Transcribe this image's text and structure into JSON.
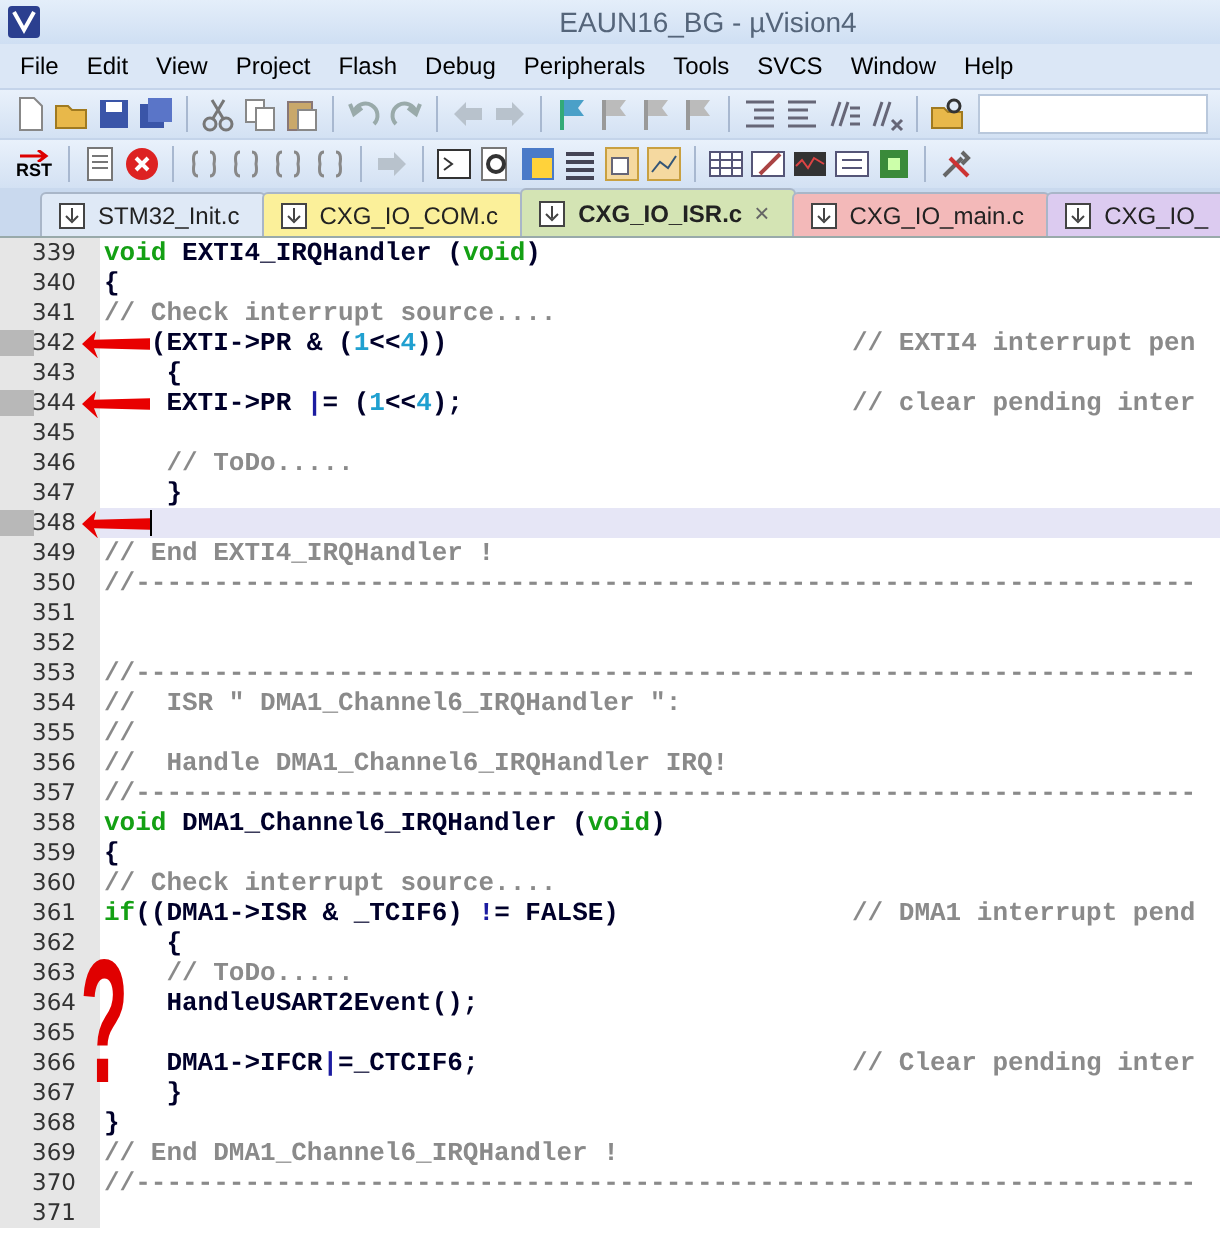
{
  "window": {
    "title": "EAUN16_BG  - µVision4"
  },
  "menu": [
    "File",
    "Edit",
    "View",
    "Project",
    "Flash",
    "Debug",
    "Peripherals",
    "Tools",
    "SVCS",
    "Window",
    "Help"
  ],
  "toolbar2": {
    "reset_label": "RST"
  },
  "tabs": [
    {
      "label": "STM32_Init.c",
      "selected": false,
      "color": "#dfe9f6"
    },
    {
      "label": "CXG_IO_COM.c",
      "selected": false,
      "color": "#fbf09a"
    },
    {
      "label": "CXG_IO_ISR.c",
      "selected": true,
      "color": "#d4e4b4",
      "close": "×"
    },
    {
      "label": "CXG_IO_main.c",
      "selected": false,
      "color": "#f3b9b9"
    },
    {
      "label": "CXG_IO_",
      "selected": false,
      "color": "#dccbf0"
    }
  ],
  "code_lines": [
    {
      "number": "339",
      "segments": [
        {
          "kind": "keyword",
          "text": "void"
        },
        {
          "kind": "plain",
          "text": " EXTI4_IRQHandler ("
        },
        {
          "kind": "keyword",
          "text": "void"
        },
        {
          "kind": "plain",
          "text": ")"
        }
      ]
    },
    {
      "number": "340",
      "segments": [
        {
          "kind": "plain",
          "text": "{"
        }
      ]
    },
    {
      "number": "341",
      "segments": [
        {
          "kind": "comment",
          "text": "// Check interrupt source...."
        }
      ]
    },
    {
      "number": "342",
      "segments": [
        {
          "kind": "plain",
          "text": "   (EXTI->PR & ("
        },
        {
          "kind": "number",
          "text": "1"
        },
        {
          "kind": "plain",
          "text": "<<"
        },
        {
          "kind": "number",
          "text": "4"
        },
        {
          "kind": "plain",
          "text": "))"
        }
      ],
      "comment": "// EXTI4 interrupt pen",
      "marked": true,
      "arrow": true
    },
    {
      "number": "343",
      "segments": [
        {
          "kind": "plain",
          "text": "    {"
        }
      ]
    },
    {
      "number": "344",
      "segments": [
        {
          "kind": "plain",
          "text": "    EXTI->PR "
        },
        {
          "kind": "operator",
          "text": "|"
        },
        {
          "kind": "plain",
          "text": "= ("
        },
        {
          "kind": "number",
          "text": "1"
        },
        {
          "kind": "plain",
          "text": "<<"
        },
        {
          "kind": "number",
          "text": "4"
        },
        {
          "kind": "plain",
          "text": ");"
        }
      ],
      "comment": "// clear pending inter",
      "marked": true,
      "arrow": true
    },
    {
      "number": "345"
    },
    {
      "number": "346",
      "segments": [
        {
          "kind": "comment",
          "text": "    // ToDo....."
        }
      ]
    },
    {
      "number": "347",
      "segments": [
        {
          "kind": "plain",
          "text": "    }"
        }
      ]
    },
    {
      "number": "348",
      "marked": true,
      "arrow": true,
      "current": true
    },
    {
      "number": "349",
      "segments": [
        {
          "kind": "comment",
          "text": "// End EXTI4_IRQHandler !"
        }
      ]
    },
    {
      "number": "350",
      "segments": [
        {
          "kind": "comment",
          "text": "//--------------------------------------------------------------------"
        }
      ]
    },
    {
      "number": "351"
    },
    {
      "number": "352"
    },
    {
      "number": "353",
      "segments": [
        {
          "kind": "comment",
          "text": "//--------------------------------------------------------------------"
        }
      ]
    },
    {
      "number": "354",
      "segments": [
        {
          "kind": "comment",
          "text": "//  ISR \" DMA1_Channel6_IRQHandler \":"
        }
      ]
    },
    {
      "number": "355",
      "segments": [
        {
          "kind": "comment",
          "text": "//"
        }
      ]
    },
    {
      "number": "356",
      "segments": [
        {
          "kind": "comment",
          "text": "//  Handle DMA1_Channel6_IRQHandler IRQ!"
        }
      ]
    },
    {
      "number": "357",
      "segments": [
        {
          "kind": "comment",
          "text": "//--------------------------------------------------------------------"
        }
      ]
    },
    {
      "number": "358",
      "segments": [
        {
          "kind": "keyword",
          "text": "void"
        },
        {
          "kind": "plain",
          "text": " DMA1_Channel6_IRQHandler ("
        },
        {
          "kind": "keyword",
          "text": "void"
        },
        {
          "kind": "plain",
          "text": ")"
        }
      ]
    },
    {
      "number": "359",
      "segments": [
        {
          "kind": "plain",
          "text": "{"
        }
      ]
    },
    {
      "number": "360",
      "segments": [
        {
          "kind": "comment",
          "text": "// Check interrupt source...."
        }
      ]
    },
    {
      "number": "361",
      "segments": [
        {
          "kind": "keyword",
          "text": "if"
        },
        {
          "kind": "plain",
          "text": "((DMA1->ISR & _TCIF6) "
        },
        {
          "kind": "operator",
          "text": "!"
        },
        {
          "kind": "plain",
          "text": "= FALSE)"
        }
      ],
      "comment": "// DMA1 interrupt pend"
    },
    {
      "number": "362",
      "segments": [
        {
          "kind": "plain",
          "text": "    {"
        }
      ]
    },
    {
      "number": "363",
      "segments": [
        {
          "kind": "comment",
          "text": "    // ToDo....."
        }
      ]
    },
    {
      "number": "364",
      "segments": [
        {
          "kind": "plain",
          "text": "    HandleUSART2Event();"
        }
      ]
    },
    {
      "number": "365"
    },
    {
      "number": "366",
      "segments": [
        {
          "kind": "plain",
          "text": "    DMA1->IFCR"
        },
        {
          "kind": "operator",
          "text": "|"
        },
        {
          "kind": "plain",
          "text": "=_CTCIF6;"
        }
      ],
      "comment": "// Clear pending inter"
    },
    {
      "number": "367",
      "segments": [
        {
          "kind": "plain",
          "text": "    }"
        }
      ]
    },
    {
      "number": "368",
      "segments": [
        {
          "kind": "plain",
          "text": "}"
        }
      ]
    },
    {
      "number": "369",
      "segments": [
        {
          "kind": "comment",
          "text": "// End DMA1_Channel6_IRQHandler !"
        }
      ]
    },
    {
      "number": "370",
      "segments": [
        {
          "kind": "comment",
          "text": "//--------------------------------------------------------------------"
        }
      ]
    },
    {
      "number": "371"
    }
  ],
  "handwritten_note": "?"
}
